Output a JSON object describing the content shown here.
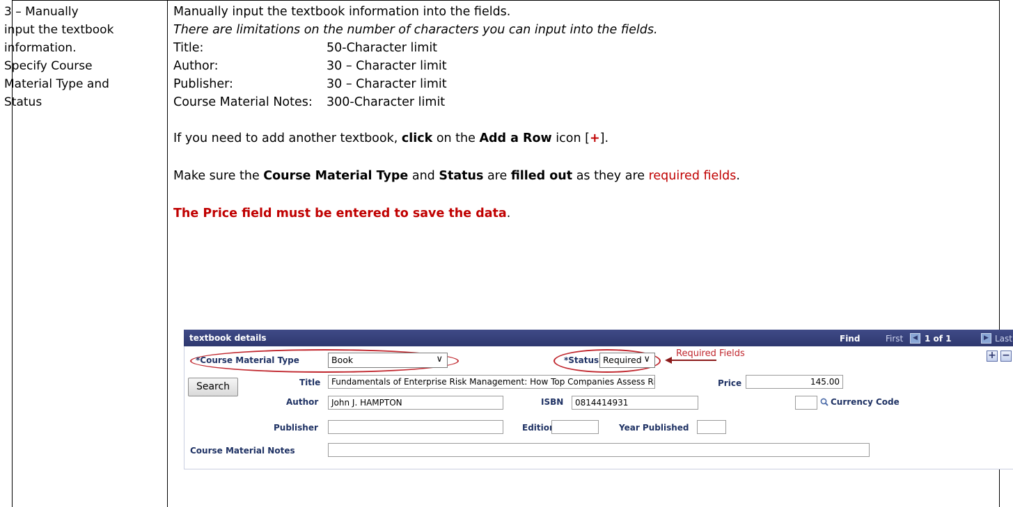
{
  "left_cell": {
    "lines": [
      "3 – Manually",
      "input the textbook",
      "information.",
      "Specify Course",
      "Material Type and",
      "Status"
    ]
  },
  "right_cell": {
    "intro": "Manually input the textbook information into the fields.",
    "limitation_note": "There are limitations on the number of characters you can input into the fields.",
    "limits": [
      {
        "label": "Title:",
        "value": "50-Character limit"
      },
      {
        "label": "Author:",
        "value": "30 – Character limit"
      },
      {
        "label": "Publisher:",
        "value": "30 – Character limit"
      },
      {
        "label": "Course Material Notes:",
        "value": "300-Character limit"
      }
    ],
    "add_row": {
      "pre": "If you need to add another textbook, ",
      "click": "click",
      "mid": " on the ",
      "add_a_row": "Add a Row",
      "post": " icon [",
      "plus": "+",
      "end": "]."
    },
    "required": {
      "pre": "Make sure the ",
      "cmt": "Course Material Type",
      "and": " and ",
      "status": "Status",
      "are": " are ",
      "filled": "filled out",
      "as": " as they are ",
      "req_fields": "required fields",
      "end": "."
    },
    "price_note": {
      "text": "The Price field must be entered to save the data",
      "end": "."
    }
  },
  "screenshot": {
    "header": {
      "title": "textbook details",
      "find": "Find",
      "first": "First",
      "count": "1 of 1",
      "last": "Last"
    },
    "course_material_type_label": "*Course Material Type",
    "course_material_type_value": "Book",
    "status_label": "*Status",
    "status_value": "Required",
    "required_fields_annotation": "Required Fields",
    "title_label": "Title",
    "title_value": "Fundamentals of Enterprise Risk Management: How Top Companies Assess Ris",
    "price_label": "Price",
    "price_value": "145.00",
    "search_button": "Search",
    "author_label": "Author",
    "author_value": "John J. HAMPTON",
    "isbn_label": "ISBN",
    "isbn_value": "0814414931",
    "currency_code_label": "Currency Code",
    "currency_code_value": "",
    "publisher_label": "Publisher",
    "publisher_value": "",
    "edition_label": "Edition",
    "edition_value": "",
    "year_published_label": "Year Published",
    "year_published_value": "",
    "course_material_notes_label": "Course Material Notes",
    "course_material_notes_value": "",
    "add_row_symbol": "+",
    "delete_row_symbol": "−",
    "prev_symbol": "◀",
    "next_symbol": "▶",
    "chevron_symbol": "∨",
    "colors": {
      "required_red": "#c0262d",
      "header_blue": "#2e386f",
      "label_blue": "#1f3264",
      "text_red": "#c00000"
    }
  }
}
